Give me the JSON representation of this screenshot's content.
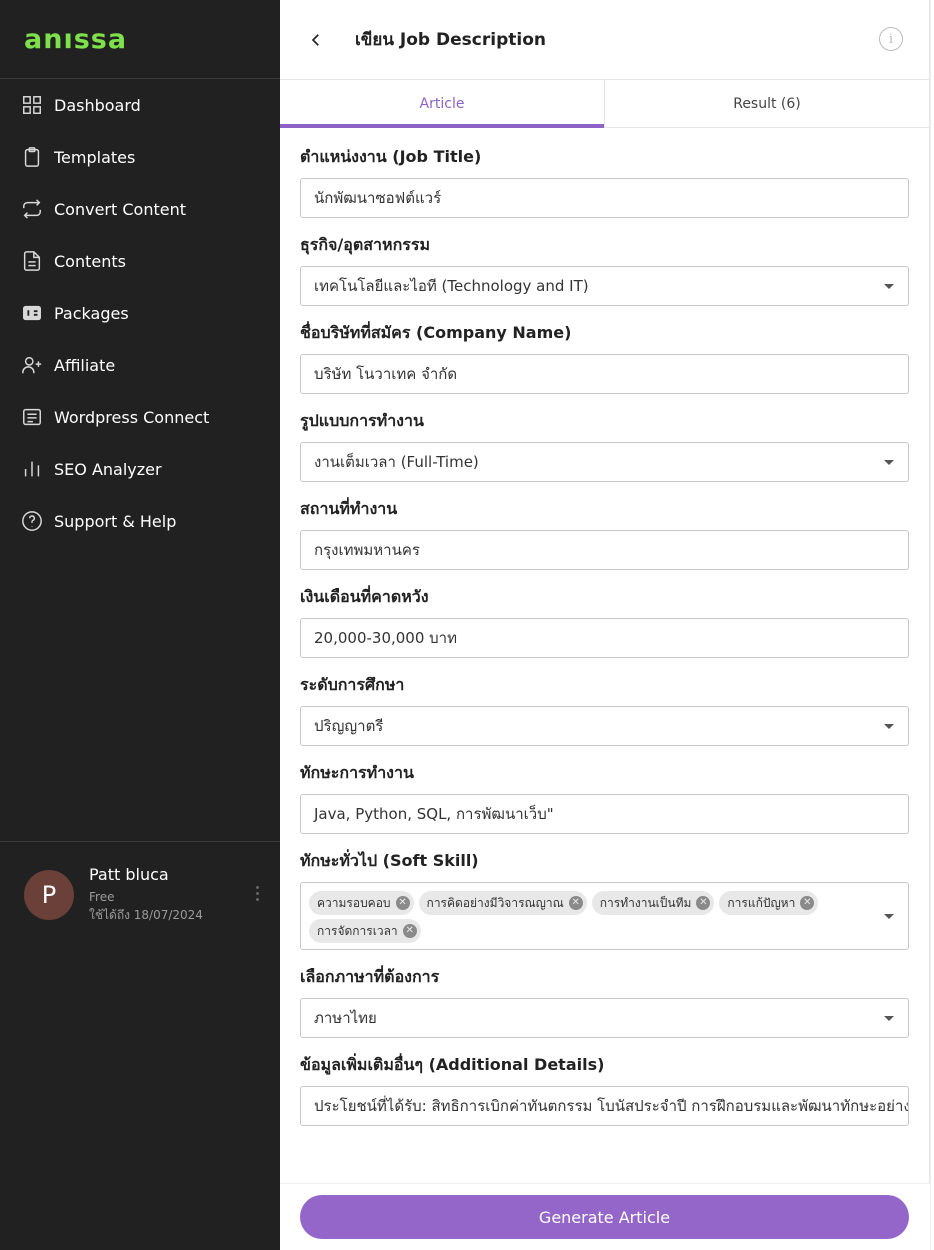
{
  "app": {
    "logo_text": "anıssa",
    "brand_color": "#7ee04a",
    "accent_color": "#9466c9"
  },
  "sidebar": {
    "items": [
      {
        "label": "Dashboard",
        "icon": "dashboard-grid-icon"
      },
      {
        "label": "Templates",
        "icon": "clipboard-icon"
      },
      {
        "label": "Convert Content",
        "icon": "convert-arrows-icon"
      },
      {
        "label": "Contents",
        "icon": "document-icon"
      },
      {
        "label": "Packages",
        "icon": "package-icon"
      },
      {
        "label": "Affiliate",
        "icon": "user-plus-icon"
      },
      {
        "label": "Wordpress Connect",
        "icon": "wordpress-icon"
      },
      {
        "label": "SEO Analyzer",
        "icon": "bar-chart-icon"
      },
      {
        "label": "Support & Help",
        "icon": "help-circle-icon"
      }
    ],
    "user": {
      "initial": "P",
      "name": "Patt bluca",
      "plan": "Free",
      "expire": "ใช้ได้ถึง 18/07/2024"
    }
  },
  "header": {
    "title": "เขียน Job Description"
  },
  "tabs": [
    {
      "label": "Article",
      "active": true
    },
    {
      "label": "Result (6)",
      "active": false
    }
  ],
  "form": {
    "job_title": {
      "label": "ตำแหน่งงาน (Job Title)",
      "value": "นักพัฒนาซอฟต์แวร์"
    },
    "industry": {
      "label": "ธุรกิจ/อุตสาหกรรม",
      "value": "เทคโนโลยีและไอที (Technology and IT)"
    },
    "company": {
      "label": "ชื่อบริษัทที่สมัคร (Company Name)",
      "value": "บริษัท โนวาเทค จำกัด"
    },
    "work_type": {
      "label": "รูปแบบการทำงาน",
      "value": "งานเต็มเวลา (Full-Time)"
    },
    "location": {
      "label": "สถานที่ทำงาน",
      "value": "กรุงเทพมหานคร"
    },
    "salary": {
      "label": "เงินเดือนที่คาดหวัง",
      "value": "20,000-30,000 บาท"
    },
    "education": {
      "label": "ระดับการศึกษา",
      "value": "ปริญญาตรี"
    },
    "skills": {
      "label": "ทักษะการทำงาน",
      "value": "Java, Python, SQL, การพัฒนาเว็บ\""
    },
    "soft_skills": {
      "label": "ทักษะทั่วไป (Soft Skill)",
      "chips": [
        "ความรอบคอบ",
        "การคิดอย่างมีวิจารณญาณ",
        "การทำงานเป็นทีม",
        "การแก้ปัญหา",
        "การจัดการเวลา"
      ]
    },
    "language": {
      "label": "เลือกภาษาที่ต้องการ",
      "value": "ภาษาไทย"
    },
    "additional": {
      "label": "ข้อมูลเพิ่มเติมอื่นๆ (Additional Details)",
      "value": "ประโยชน์ที่ได้รับ: สิทธิการเบิกค่าทันตกรรม โบนัสประจำปี การฝึกอบรมและพัฒนาทักษะอย่างต่อเนื่อง"
    }
  },
  "footer": {
    "generate_label": "Generate Article"
  }
}
